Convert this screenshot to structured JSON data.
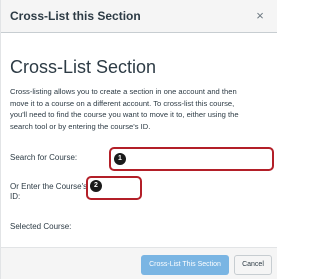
{
  "dialog": {
    "title": "Cross-List this Section",
    "close_label": "×"
  },
  "main": {
    "heading": "Cross-List Section",
    "description_lines": [
      "Cross-listing allows you to create a section in one account and then",
      "move it to a course on a different account. To cross-list this course,",
      "you'll need to find the course you want to move it to, either using the",
      "search tool or by entering the course's ID."
    ],
    "search_label": "Search for Course:",
    "search_value": "",
    "badge_1": "1",
    "course_id_label_line1": "Or Enter the Course's",
    "course_id_label_line2": "ID:",
    "course_id_value": "",
    "badge_2": "2",
    "selected_label": "Selected Course:"
  },
  "footer": {
    "crosslist_label": "Cross-List This Section",
    "cancel_label": "Cancel"
  },
  "colors": {
    "field_highlight": "#b31f28",
    "primary_button": "#7ab5e3",
    "badge": "#1b1b1b"
  }
}
